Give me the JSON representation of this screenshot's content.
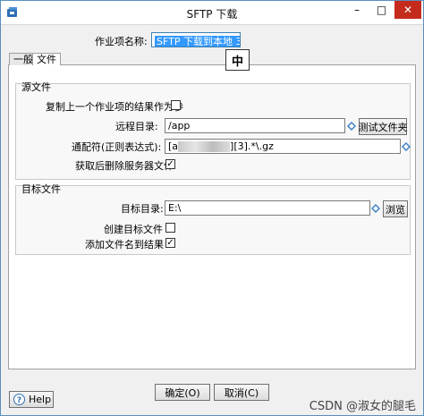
{
  "window": {
    "title": "SFTP 下载"
  },
  "titlebar": {
    "minimize": "–",
    "maximize": "□",
    "close": "✕"
  },
  "job_name": {
    "label": "作业项名称:",
    "value": "SFTP 下载到本地 3"
  },
  "ime": {
    "indicator": "中"
  },
  "tabs": [
    {
      "label": "一般"
    },
    {
      "label": "文件"
    }
  ],
  "source_group": {
    "title": "源文件",
    "copy_prev_label": "复制上一个作业项的结果作为参",
    "copy_prev_checked": false,
    "remote_dir_label": "远程目录:",
    "remote_dir_value": "/app",
    "test_folder_button": "测试文件夹",
    "wildcard_label": "通配符(正则表达式):",
    "wildcard_prefix": "[a",
    "wildcard_suffix": "][3].*\\.gz",
    "delete_after_label": "获取后删除服务器文件",
    "delete_after_checked": true,
    "check_mark": "✓"
  },
  "target_group": {
    "title": "目标文件",
    "target_dir_label": "目标目录:",
    "target_dir_value": "E:\\",
    "browse_button": "浏览",
    "create_dir_label": "创建目标文件",
    "create_dir_checked": false,
    "add_to_result_label": "添加文件名到结果",
    "add_to_result_checked": true
  },
  "footer": {
    "help_button": "Help",
    "ok_button": "确定(O)",
    "cancel_button": "取消(C)"
  },
  "watermark": "CSDN @淑女的腿毛",
  "colors": {
    "close_red": "#c42b1c",
    "selection_blue": "#3399ff",
    "focus_border": "#3c7fb1"
  }
}
